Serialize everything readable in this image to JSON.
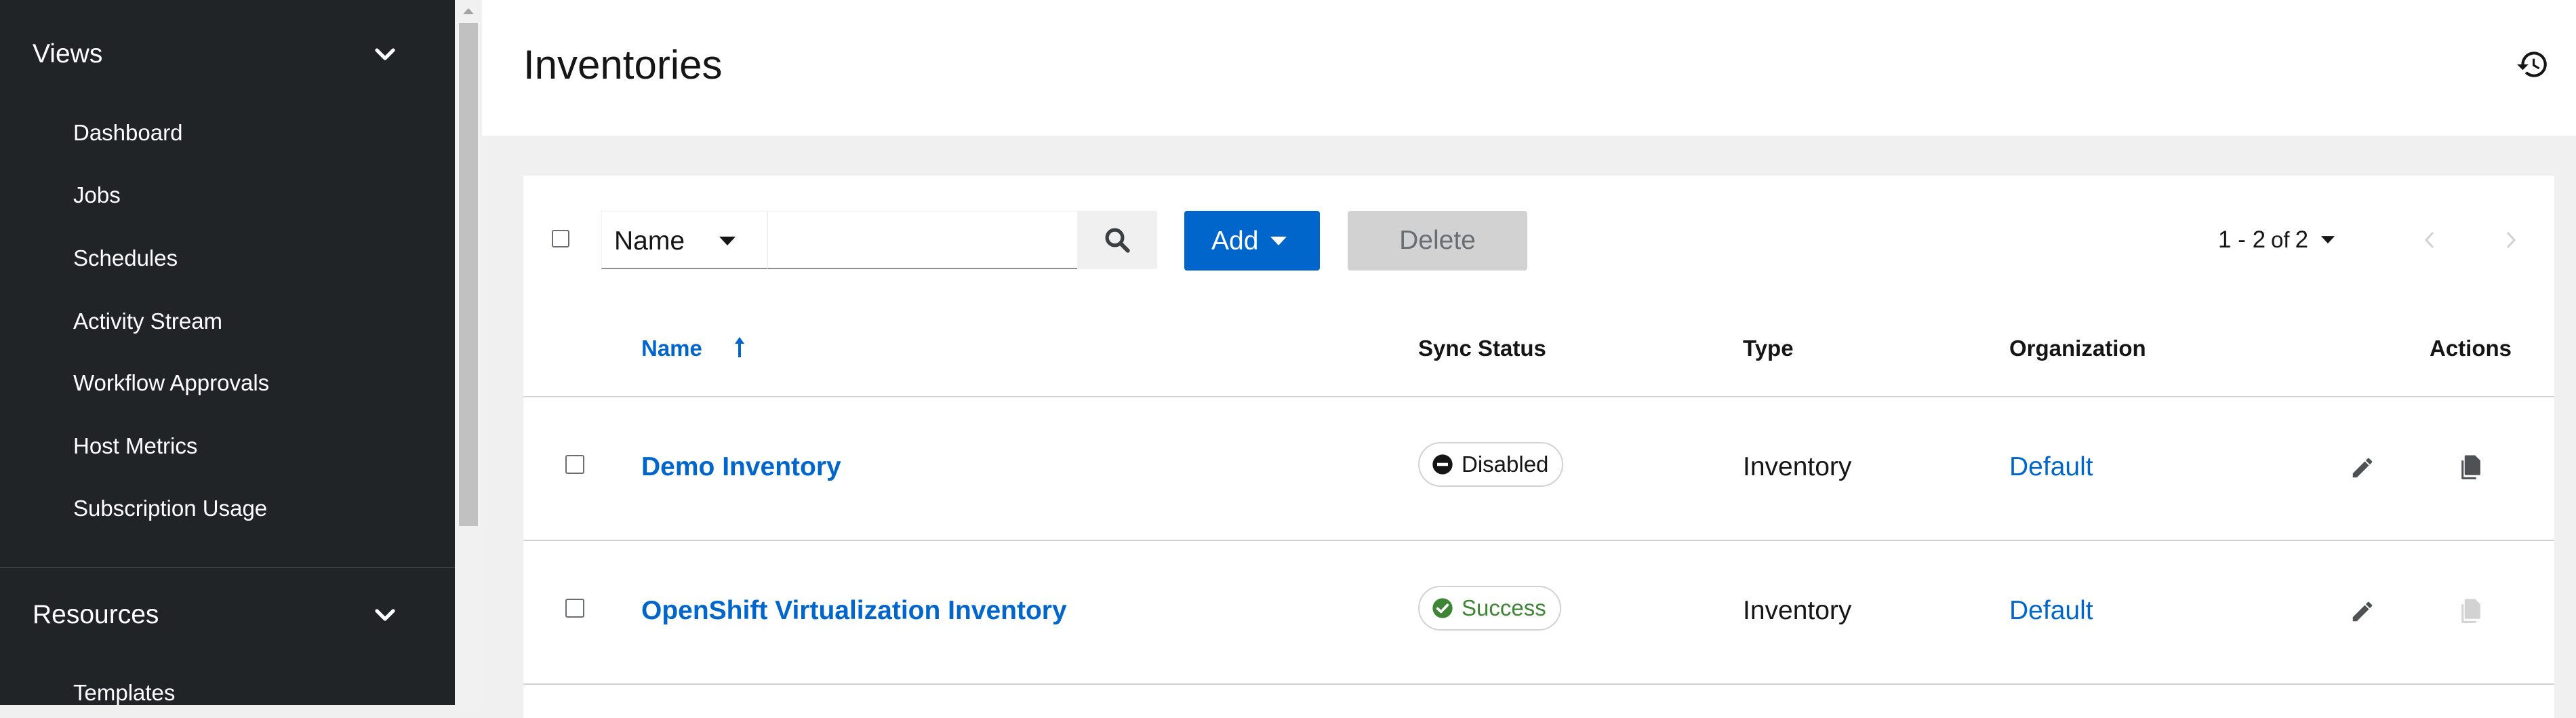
{
  "sidebar": {
    "groups": [
      {
        "label": "Views",
        "items": [
          {
            "label": "Dashboard"
          },
          {
            "label": "Jobs"
          },
          {
            "label": "Schedules"
          },
          {
            "label": "Activity Stream"
          },
          {
            "label": "Workflow Approvals"
          },
          {
            "label": "Host Metrics"
          },
          {
            "label": "Subscription Usage"
          }
        ]
      },
      {
        "label": "Resources",
        "items": [
          {
            "label": "Templates"
          }
        ]
      }
    ]
  },
  "header": {
    "title": "Inventories",
    "history_icon": "history-icon"
  },
  "toolbar": {
    "filter_field": "Name",
    "search_placeholder": "",
    "add_label": "Add",
    "delete_label": "Delete",
    "pagination": {
      "range": "1 - 2",
      "of_label": "of",
      "total": "2"
    }
  },
  "table": {
    "columns": {
      "name": "Name",
      "sync_status": "Sync Status",
      "type": "Type",
      "organization": "Organization",
      "actions": "Actions"
    },
    "rows": [
      {
        "name": "Demo Inventory",
        "sync_status": "Disabled",
        "type": "Inventory",
        "organization": "Default"
      },
      {
        "name": "OpenShift Virtualization Inventory",
        "sync_status": "Success",
        "type": "Inventory",
        "organization": "Default"
      }
    ]
  },
  "colors": {
    "sidebar_bg": "#212427",
    "link_blue": "#0066cc",
    "success_green": "#3e8635",
    "disabled_dark": "#151515"
  }
}
